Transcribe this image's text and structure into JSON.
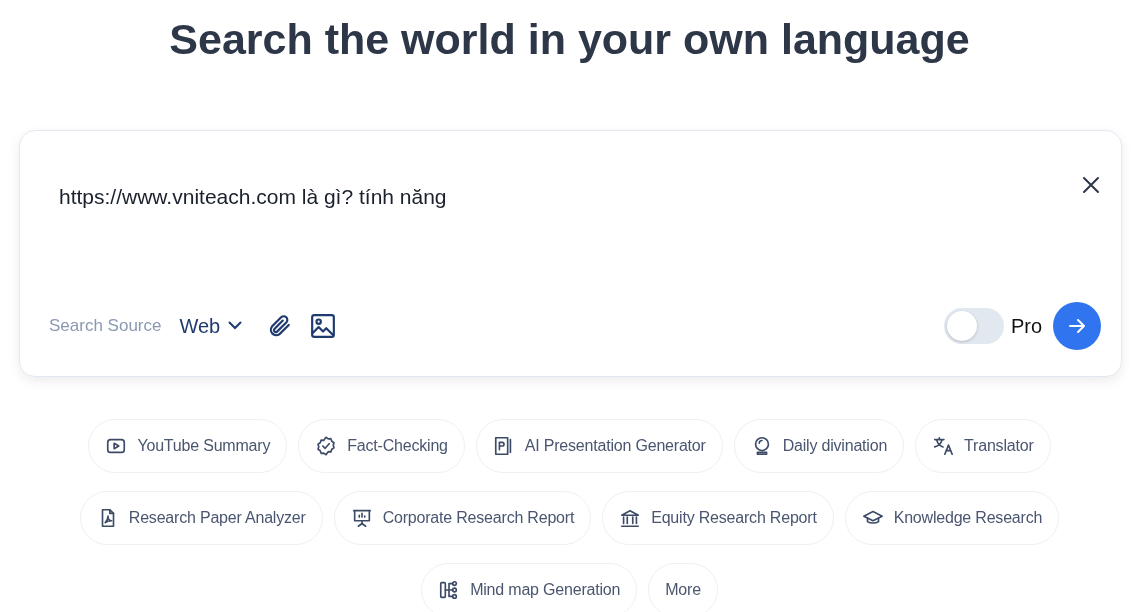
{
  "heading": "Search the world in your own language",
  "search": {
    "query": "https://www.vniteach.com là gì? tính năng",
    "source_label": "Search Source",
    "source_value": "Web",
    "pro": {
      "label": "Pro",
      "on": false
    }
  },
  "chips": [
    {
      "label": "YouTube Summary",
      "kind": "tool"
    },
    {
      "label": "Fact-Checking",
      "kind": "tool"
    },
    {
      "label": "AI Presentation Generator",
      "kind": "tool"
    },
    {
      "label": "Daily divination",
      "kind": "tool"
    },
    {
      "label": "Translator",
      "kind": "tool"
    },
    {
      "label": "Research Paper Analyzer",
      "kind": "tool"
    },
    {
      "label": "Corporate Research Report",
      "kind": "tool"
    },
    {
      "label": "Equity Research Report",
      "kind": "tool"
    },
    {
      "label": "Knowledge Research",
      "kind": "tool"
    },
    {
      "label": "Mind map Generation",
      "kind": "tool"
    },
    {
      "label": "More",
      "kind": "more"
    }
  ]
}
